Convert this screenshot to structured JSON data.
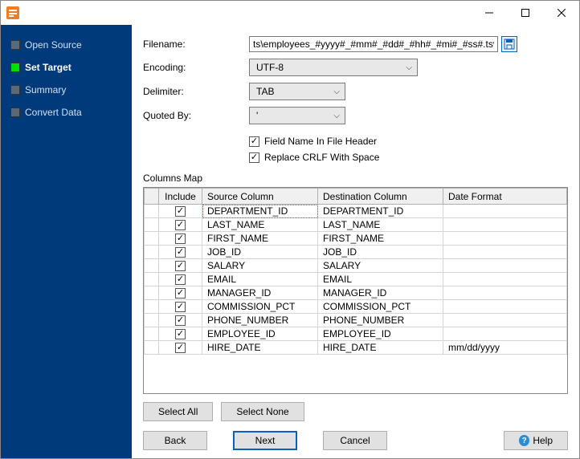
{
  "window": {
    "title": ""
  },
  "nav": {
    "items": [
      {
        "label": "Open Source",
        "active": false
      },
      {
        "label": "Set Target",
        "active": true
      },
      {
        "label": "Summary",
        "active": false
      },
      {
        "label": "Convert Data",
        "active": false
      }
    ]
  },
  "form": {
    "filename_label": "Filename:",
    "filename_value": "ts\\employees_#yyyy#_#mm#_#dd#_#hh#_#mi#_#ss#.tsv",
    "encoding_label": "Encoding:",
    "encoding_value": "UTF-8",
    "delimiter_label": "Delimiter:",
    "delimiter_value": "TAB",
    "quoted_label": "Quoted By:",
    "quoted_value": "'",
    "cb_fieldname": "Field Name In File Header",
    "cb_crlf": "Replace CRLF With Space"
  },
  "columns_map_label": "Columns Map",
  "table": {
    "headers": {
      "include": "Include",
      "source": "Source Column",
      "dest": "Destination Column",
      "datefmt": "Date Format"
    },
    "rows": [
      {
        "include": true,
        "source": "DEPARTMENT_ID",
        "dest": "DEPARTMENT_ID",
        "datefmt": "",
        "selected": true
      },
      {
        "include": true,
        "source": "LAST_NAME",
        "dest": "LAST_NAME",
        "datefmt": ""
      },
      {
        "include": true,
        "source": "FIRST_NAME",
        "dest": "FIRST_NAME",
        "datefmt": ""
      },
      {
        "include": true,
        "source": "JOB_ID",
        "dest": "JOB_ID",
        "datefmt": ""
      },
      {
        "include": true,
        "source": "SALARY",
        "dest": "SALARY",
        "datefmt": ""
      },
      {
        "include": true,
        "source": "EMAIL",
        "dest": "EMAIL",
        "datefmt": ""
      },
      {
        "include": true,
        "source": "MANAGER_ID",
        "dest": "MANAGER_ID",
        "datefmt": ""
      },
      {
        "include": true,
        "source": "COMMISSION_PCT",
        "dest": "COMMISSION_PCT",
        "datefmt": ""
      },
      {
        "include": true,
        "source": "PHONE_NUMBER",
        "dest": "PHONE_NUMBER",
        "datefmt": ""
      },
      {
        "include": true,
        "source": "EMPLOYEE_ID",
        "dest": "EMPLOYEE_ID",
        "datefmt": ""
      },
      {
        "include": true,
        "source": "HIRE_DATE",
        "dest": "HIRE_DATE",
        "datefmt": "mm/dd/yyyy"
      }
    ]
  },
  "buttons": {
    "select_all": "Select All",
    "select_none": "Select None",
    "back": "Back",
    "next": "Next",
    "cancel": "Cancel",
    "help": "Help"
  }
}
